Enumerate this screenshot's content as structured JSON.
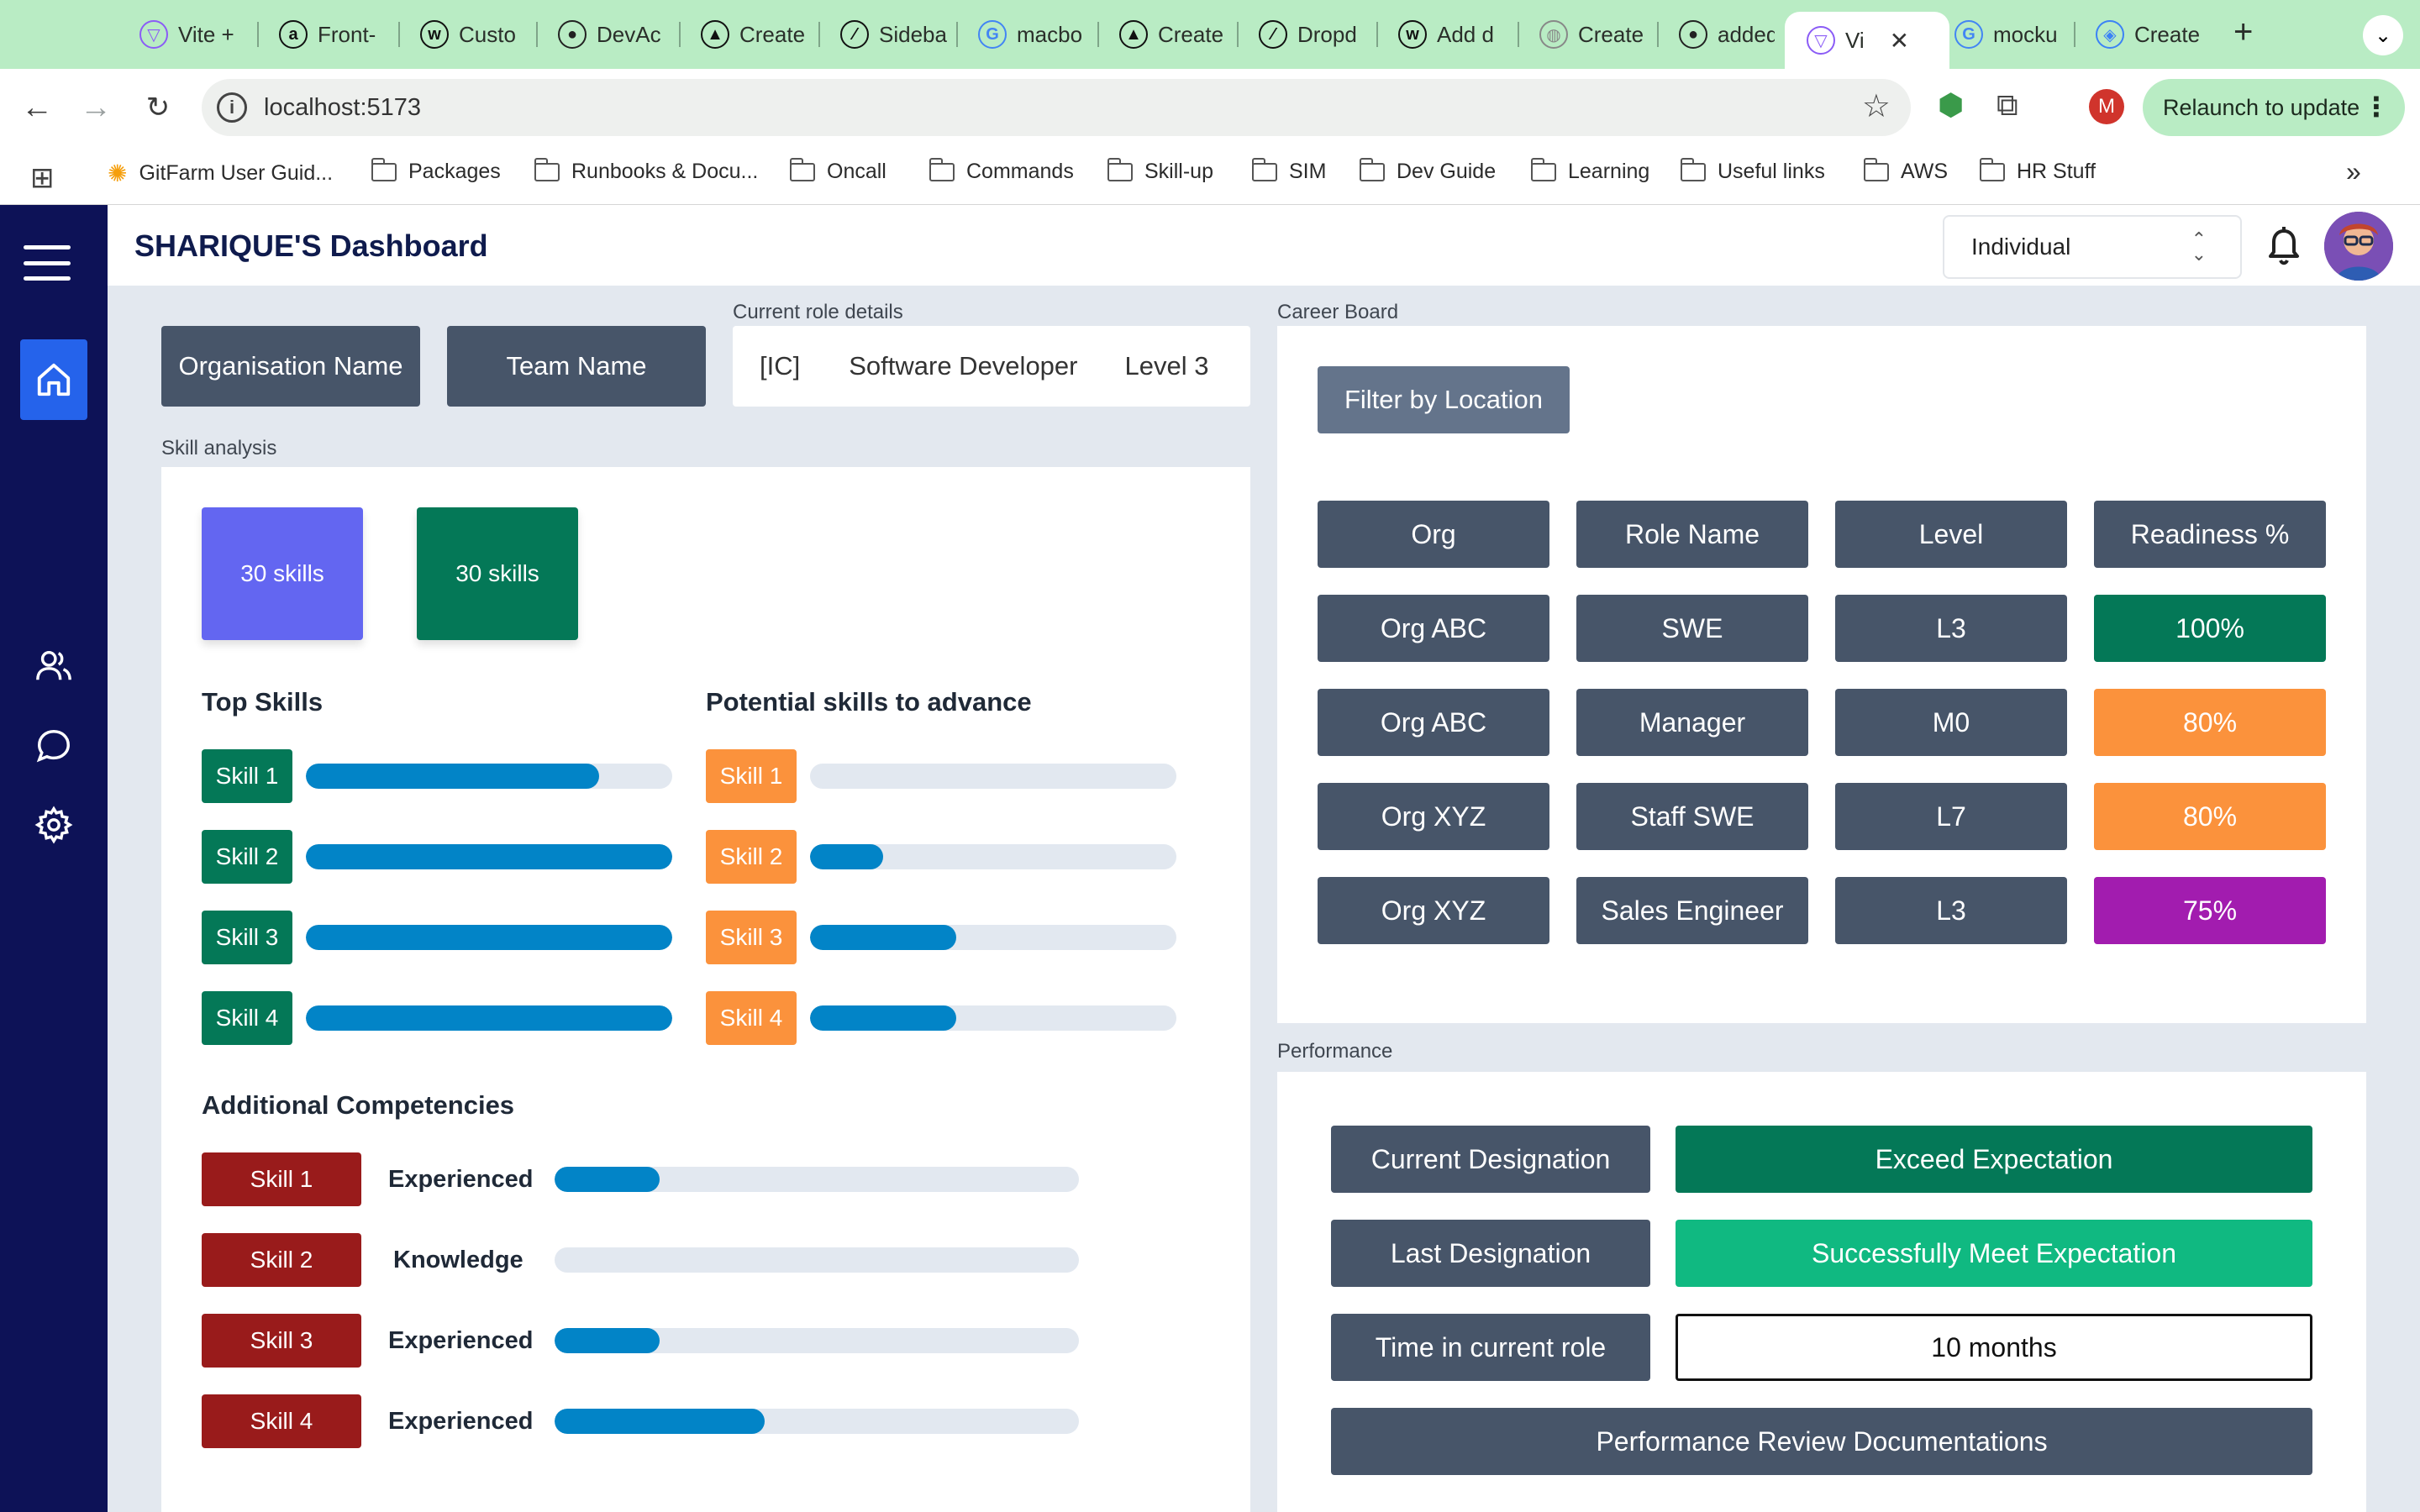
{
  "browser": {
    "tabs": [
      {
        "label": "Vite +",
        "icon": "vite-icon"
      },
      {
        "label": "Front-",
        "icon": "amazon-icon"
      },
      {
        "label": "Custo",
        "icon": "webflow-icon"
      },
      {
        "label": "DevAc",
        "icon": "github-icon"
      },
      {
        "label": "Create",
        "icon": "triangle-icon"
      },
      {
        "label": "Sideba",
        "icon": "slash-icon"
      },
      {
        "label": "macbo",
        "icon": "google-icon"
      },
      {
        "label": "Create",
        "icon": "triangle-icon"
      },
      {
        "label": "Dropd",
        "icon": "slash-icon"
      },
      {
        "label": "Add d",
        "icon": "webflow-icon"
      },
      {
        "label": "Create",
        "icon": "globe-icon"
      },
      {
        "label": "added",
        "icon": "github-icon"
      },
      {
        "label": "Vi",
        "icon": "vite-icon",
        "active": true
      },
      {
        "label": "mocku",
        "icon": "google-icon"
      },
      {
        "label": "Create",
        "icon": "layers-icon"
      }
    ],
    "url": "localhost:5173",
    "profile_initial": "M",
    "relaunch_label": "Relaunch to update",
    "bookmarks": [
      {
        "label": "GitFarm User Guid...",
        "icon": "gitfarm-icon"
      },
      {
        "label": "Packages",
        "icon": "folder-icon"
      },
      {
        "label": "Runbooks & Docu...",
        "icon": "folder-icon"
      },
      {
        "label": "Oncall",
        "icon": "folder-icon"
      },
      {
        "label": "Commands",
        "icon": "folder-icon"
      },
      {
        "label": "Skill-up",
        "icon": "folder-icon"
      },
      {
        "label": "SIM",
        "icon": "folder-icon"
      },
      {
        "label": "Dev Guide",
        "icon": "folder-icon"
      },
      {
        "label": "Learning",
        "icon": "folder-icon"
      },
      {
        "label": "Useful links",
        "icon": "folder-icon"
      },
      {
        "label": "AWS",
        "icon": "folder-icon"
      },
      {
        "label": "HR Stuff",
        "icon": "folder-icon"
      }
    ]
  },
  "header": {
    "title": "SHARIQUE'S Dashboard",
    "view_select": "Individual"
  },
  "sidebar": {
    "items": [
      {
        "name": "home-icon",
        "active": true
      },
      {
        "name": "users-icon"
      },
      {
        "name": "chat-icon"
      },
      {
        "name": "gear-icon"
      }
    ]
  },
  "org": {
    "organisation": "Organisation Name",
    "team": "Team Name"
  },
  "role": {
    "label": "Current role details",
    "type": "[IC]",
    "title": "Software Developer",
    "level": "Level 3"
  },
  "skill_analysis": {
    "label": "Skill analysis",
    "stats": [
      {
        "text": "30 skills",
        "color": "#6366f1"
      },
      {
        "text": "30 skills",
        "color": "#047857"
      }
    ],
    "top_skills": {
      "title": "Top Skills",
      "chip_color": "#047857",
      "items": [
        {
          "label": "Skill 1",
          "progress": 0.8
        },
        {
          "label": "Skill 2",
          "progress": 1.0
        },
        {
          "label": "Skill 3",
          "progress": 1.0
        },
        {
          "label": "Skill 4",
          "progress": 1.0
        }
      ]
    },
    "potential_skills": {
      "title": "Potential skills to advance",
      "chip_color": "#fb923c",
      "items": [
        {
          "label": "Skill 1",
          "progress": 0.0
        },
        {
          "label": "Skill 2",
          "progress": 0.2
        },
        {
          "label": "Skill 3",
          "progress": 0.4
        },
        {
          "label": "Skill 4",
          "progress": 0.4
        }
      ]
    },
    "additional": {
      "title": "Additional Competencies",
      "chip_color": "#991b1b",
      "items": [
        {
          "label": "Skill 1",
          "level": "Experienced",
          "progress": 0.2
        },
        {
          "label": "Skill 2",
          "level": "Knowledge",
          "progress": 0.0
        },
        {
          "label": "Skill 3",
          "level": "Experienced",
          "progress": 0.2
        },
        {
          "label": "Skill 4",
          "level": "Experienced",
          "progress": 0.4
        }
      ]
    }
  },
  "career_board": {
    "label": "Career Board",
    "filter_label": "Filter by Location",
    "columns": [
      "Org",
      "Role Name",
      "Level",
      "Readiness %"
    ],
    "rows": [
      {
        "org": "Org ABC",
        "role": "SWE",
        "level": "L3",
        "readiness": "100%",
        "color": "#047857"
      },
      {
        "org": "Org ABC",
        "role": "Manager",
        "level": "M0",
        "readiness": "80%",
        "color": "#fb923c"
      },
      {
        "org": "Org XYZ",
        "role": "Staff SWE",
        "level": "L7",
        "readiness": "80%",
        "color": "#fb923c"
      },
      {
        "org": "Org XYZ",
        "role": "Sales Engineer",
        "level": "L3",
        "readiness": "75%",
        "color": "#a21caf"
      }
    ]
  },
  "performance": {
    "label": "Performance",
    "current_designation": "Current Designation",
    "current_value": "Exceed Expectation",
    "last_designation": "Last Designation",
    "last_value": "Successfully Meet Expectation",
    "time_label": "Time in current role",
    "time_value": "10 months",
    "docs_label": "Performance Review Documentations"
  }
}
